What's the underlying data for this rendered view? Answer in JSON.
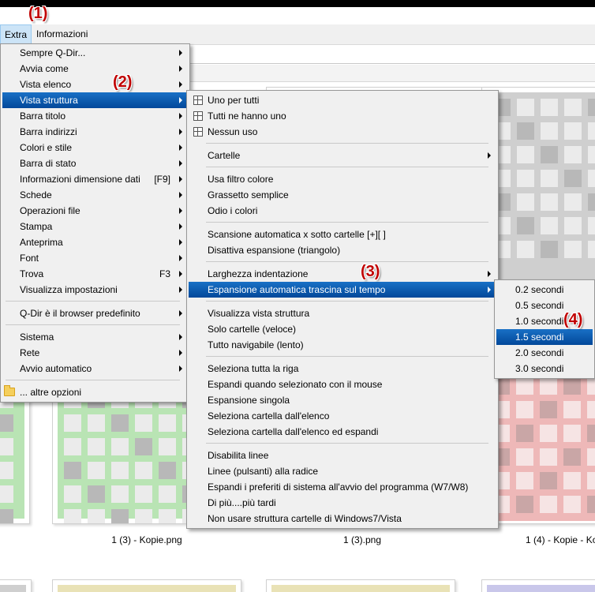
{
  "annotations": [
    "(1)",
    "(2)",
    "(3)",
    "(4)"
  ],
  "menubar": {
    "items": [
      "Extra",
      "Informazioni"
    ]
  },
  "menu_extra": {
    "items": [
      {
        "label": "Sempre Q-Dir...",
        "submenu": true
      },
      {
        "label": "Avvia come",
        "submenu": true
      },
      {
        "label": "Vista elenco",
        "submenu": true
      },
      {
        "label": "Vista struttura",
        "submenu": true,
        "highlighted": true
      },
      {
        "label": "Barra titolo",
        "submenu": true
      },
      {
        "label": "Barra indirizzi",
        "submenu": true
      },
      {
        "label": "Colori e stile",
        "submenu": true
      },
      {
        "label": "Barra di stato",
        "submenu": true
      },
      {
        "label": "Informazioni dimensione dati",
        "shortcut": "[F9]",
        "submenu": true
      },
      {
        "label": "Schede",
        "submenu": true
      },
      {
        "label": "Operazioni file",
        "submenu": true
      },
      {
        "label": "Stampa",
        "submenu": true
      },
      {
        "label": "Anteprima",
        "submenu": true
      },
      {
        "label": "Font",
        "submenu": true
      },
      {
        "label": "Trova",
        "shortcut": "F3",
        "submenu": true
      },
      {
        "label": "Visualizza impostazioni",
        "submenu": true
      },
      {
        "label": "Q-Dir è il browser predefinito",
        "submenu": true
      },
      {
        "label": "Sistema",
        "submenu": true
      },
      {
        "label": "Rete",
        "submenu": true
      },
      {
        "label": "Avvio automatico",
        "submenu": true
      },
      {
        "label": "... altre opzioni",
        "submenu": false,
        "icon": "folder-icon"
      }
    ]
  },
  "menu_struttura": {
    "items": [
      {
        "label": "Uno per tutti",
        "icon": "grid-icon"
      },
      {
        "label": "Tutti ne hanno uno",
        "icon": "grid-icon"
      },
      {
        "label": "Nessun uso",
        "icon": "grid-icon"
      },
      {
        "label": "Cartelle",
        "submenu": true
      },
      {
        "label": "Usa filtro colore"
      },
      {
        "label": "Grassetto semplice"
      },
      {
        "label": "Odio i colori"
      },
      {
        "label": "Scansione automatica x sotto cartelle [+][ ]"
      },
      {
        "label": "Disattiva espansione (triangolo)"
      },
      {
        "label": "Larghezza indentazione",
        "submenu": true
      },
      {
        "label": "Espansione automatica trascina sul tempo",
        "submenu": true,
        "highlighted": true
      },
      {
        "label": "Visualizza vista struttura"
      },
      {
        "label": "Solo cartelle (veloce)"
      },
      {
        "label": "Tutto navigabile (lento)"
      },
      {
        "label": "Seleziona tutta la riga"
      },
      {
        "label": "Espandi quando selezionato con il mouse"
      },
      {
        "label": "Espansione singola"
      },
      {
        "label": "Seleziona cartella dall'elenco"
      },
      {
        "label": "Seleziona cartella dall'elenco ed espandi"
      },
      {
        "label": "Disabilita linee"
      },
      {
        "label": "Linee (pulsanti) alla radice"
      },
      {
        "label": "Espandi i preferiti di sistema all'avvio del programma (W7/W8)"
      },
      {
        "label": "Di più....più tardi"
      },
      {
        "label": "Non usare struttura cartelle di Windows7/Vista"
      }
    ]
  },
  "menu_tempo": {
    "items": [
      {
        "label": "0.2 secondi"
      },
      {
        "label": "0.5 secondi"
      },
      {
        "label": "1.0 secondi"
      },
      {
        "label": "1.5 secondi",
        "highlighted": true
      },
      {
        "label": "2.0 secondi"
      },
      {
        "label": "3.0 secondi"
      }
    ]
  },
  "thumbnails": {
    "captions": [
      "1 (3) - Kopie.png",
      "1 (3).png",
      "1 (4) - Kopie - Ko"
    ],
    "colors": {
      "gray": "#cfcfcf",
      "green": "#b9e4b4",
      "red": "#eeb8b8",
      "yellow": "#e9e2b6",
      "purple": "#c9c7ea",
      "cell": "#b8b8b8"
    }
  },
  "colors": {
    "highlight": "#0a5fb4",
    "menu_bg": "#f0f0f0",
    "annotation": "#c00000"
  }
}
